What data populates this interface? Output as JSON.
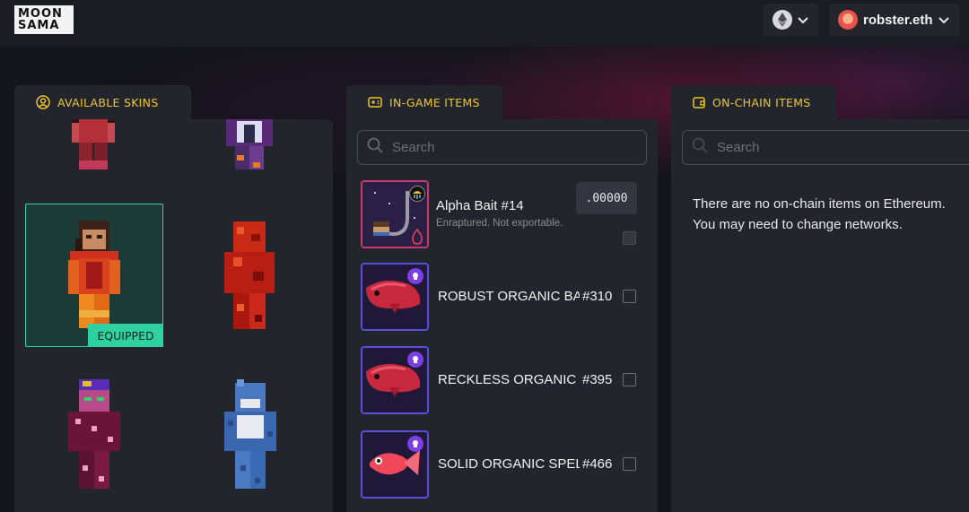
{
  "header": {
    "logo_line1": "MOON",
    "logo_line2": "SAMA",
    "network_icon": "ethereum-icon",
    "user_name": "robster.eth"
  },
  "panels": {
    "skins": {
      "tab_label": "AVAILABLE SKINS",
      "equipped_label": "EQUIPPED"
    },
    "ingame": {
      "tab_label": "IN-GAME ITEMS",
      "search_placeholder": "Search",
      "items": [
        {
          "name": "Alpha Bait #14",
          "subtitle": "Enraptured. Not exportable.",
          "quantity": ".00000"
        },
        {
          "name": "ROBUST ORGANIC BAI",
          "number": "#310"
        },
        {
          "name": "RECKLESS ORGANIC B",
          "number": "#395"
        },
        {
          "name": "SOLID ORGANIC SPEL",
          "number": "#466"
        }
      ]
    },
    "onchain": {
      "tab_label": "ON-CHAIN ITEMS",
      "search_placeholder": "Search",
      "empty_line1": "There are no on-chain items on Ethereum.",
      "empty_line2": "You may need to change networks."
    }
  },
  "colors": {
    "accent_yellow": "#f0c52c",
    "equipped_green": "#2fd1a1",
    "panel_bg": "#23252d",
    "header_bg": "#1b1c23"
  }
}
